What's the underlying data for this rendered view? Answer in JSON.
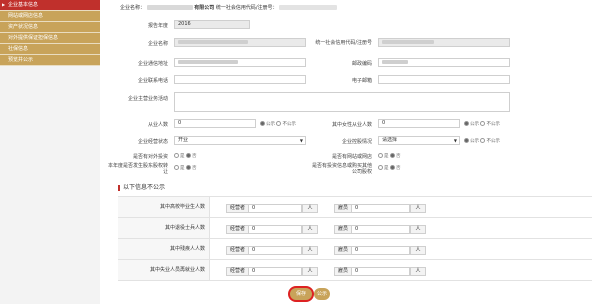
{
  "sidebar": {
    "items": [
      {
        "label": "企业基本信息",
        "active": true
      },
      {
        "label": "网站或网店信息",
        "active": false
      },
      {
        "label": "资产状况信息",
        "active": false
      },
      {
        "label": "对外提供保证担保信息",
        "active": false
      },
      {
        "label": "社保信息",
        "active": false
      },
      {
        "label": "预览并公示",
        "active": false
      }
    ]
  },
  "header": {
    "company_prefix": "企业名称：",
    "company_suffix": "有限公司",
    "credit_label": "统一社会信用代码/注册号："
  },
  "form": {
    "report_year_label": "报告年度",
    "report_year_value": "2016",
    "company_name_label": "企业名称",
    "credit_code_label": "统一社会信用代码/注册号",
    "address_label": "企业通信地址",
    "postcode_label": "邮政编码",
    "phone_label": "企业联系电话",
    "email_label": "电子邮箱",
    "business_label": "企业主营业务活动",
    "employees_label": "从业人数",
    "employees_value": "0",
    "female_label": "其中女性从业人数",
    "female_value": "0",
    "public_on": "公示",
    "public_off": "不公示",
    "status_label": "企业经营状态",
    "status_value": "开业",
    "holding_label": "企业控股情况",
    "holding_value": "请选择",
    "invest_label": "是否有对外投资",
    "website_label": "是否有网站或网店",
    "transfer_label": "本年度是否发生股东股权转让",
    "buy_label": "是否有投资信息或购买其他公司股权",
    "yes": "是",
    "no": "否"
  },
  "section": {
    "title": "以下信息不公示"
  },
  "stats_table": {
    "rows": [
      {
        "label": "其中高校毕业生人数",
        "a_prefix": "经营者",
        "a_value": "0",
        "b_prefix": "雇员",
        "b_value": "0",
        "unit": "人"
      },
      {
        "label": "其中退役士兵人数",
        "a_prefix": "经营者",
        "a_value": "0",
        "b_prefix": "雇员",
        "b_value": "0",
        "unit": "人"
      },
      {
        "label": "其中残疾人人数",
        "a_prefix": "经营者",
        "a_value": "0",
        "b_prefix": "雇员",
        "b_value": "0",
        "unit": "人"
      },
      {
        "label": "其中失业人员再就业人数",
        "a_prefix": "经营者",
        "a_value": "0",
        "b_prefix": "雇员",
        "b_value": "0",
        "unit": "人"
      }
    ]
  },
  "buttons": {
    "save": "保存",
    "submit": "公示"
  }
}
